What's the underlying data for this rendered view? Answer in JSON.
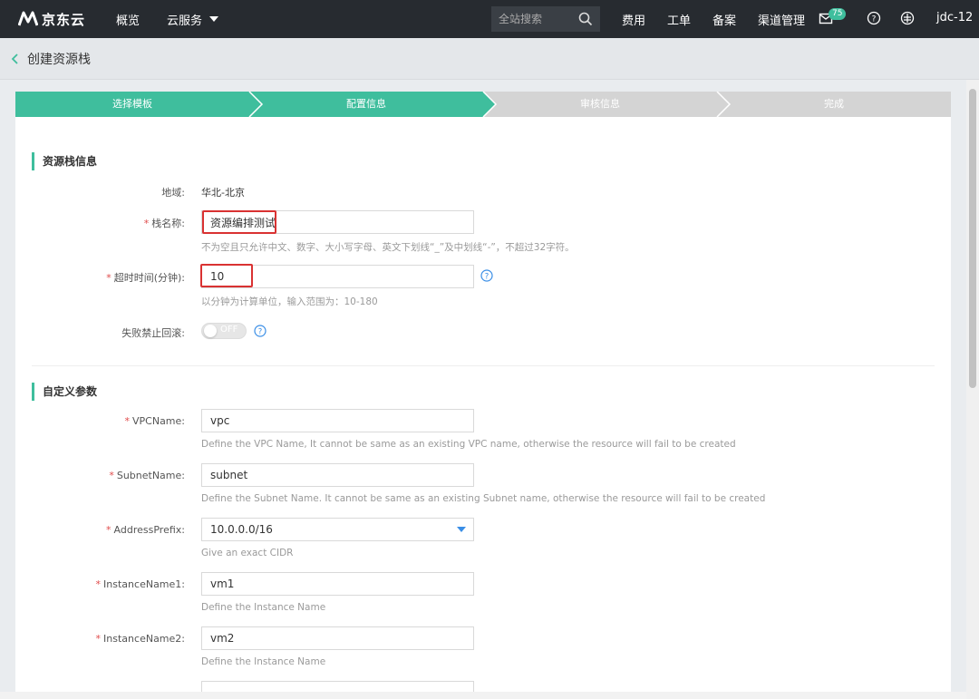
{
  "brand": {
    "logo_text": "京东云"
  },
  "topnav": {
    "overview": "概览",
    "cloud_services": "云服务",
    "search_placeholder": "全站搜索",
    "fees": "费用",
    "tickets": "工单",
    "icp": "备案",
    "channel": "渠道管理",
    "message_count": "75",
    "user": "jdc-12"
  },
  "breadcrumb": {
    "title": "创建资源栈"
  },
  "steps": [
    {
      "label": "选择模板",
      "state": "done"
    },
    {
      "label": "配置信息",
      "state": "active"
    },
    {
      "label": "审核信息",
      "state": "todo"
    },
    {
      "label": "完成",
      "state": "todo"
    }
  ],
  "stack_info": {
    "title": "资源栈信息",
    "region_label": "地域:",
    "region_value": "华北-北京",
    "name_label": "栈名称:",
    "name_value": "资源编排测试",
    "name_hint": "不为空且只允许中文、数字、大小写字母、英文下划线“_”及中划线“-”，不超过32字符。",
    "timeout_label": "超时时间(分钟):",
    "timeout_value": "10",
    "timeout_hint": "以分钟为计算单位，输入范围为：10-180",
    "rollback_label": "失败禁止回滚:",
    "rollback_toggle": "OFF"
  },
  "custom_params": {
    "title": "自定义参数",
    "vpc_label": "VPCName:",
    "vpc_value": "vpc",
    "vpc_hint": "Define the VPC Name, It cannot be same as an existing VPC name, otherwise the resource will fail to be created",
    "subnet_label": "SubnetName:",
    "subnet_value": "subnet",
    "subnet_hint": "Define the Subnet Name. It cannot be same as an existing Subnet name, otherwise the resource will fail to be created",
    "prefix_label": "AddressPrefix:",
    "prefix_value": "10.0.0.0/16",
    "prefix_hint": "Give an exact CIDR",
    "inst1_label": "InstanceName1:",
    "inst1_value": "vm1",
    "inst1_hint": "Define the Instance Name",
    "inst2_label": "InstanceName2:",
    "inst2_value": "vm2",
    "inst2_hint": "Define the Instance Name"
  },
  "colors": {
    "accent": "#3fbe9d",
    "step_todo": "#d4d4d4",
    "highlight": "#d93232",
    "topbar": "#272b30"
  }
}
